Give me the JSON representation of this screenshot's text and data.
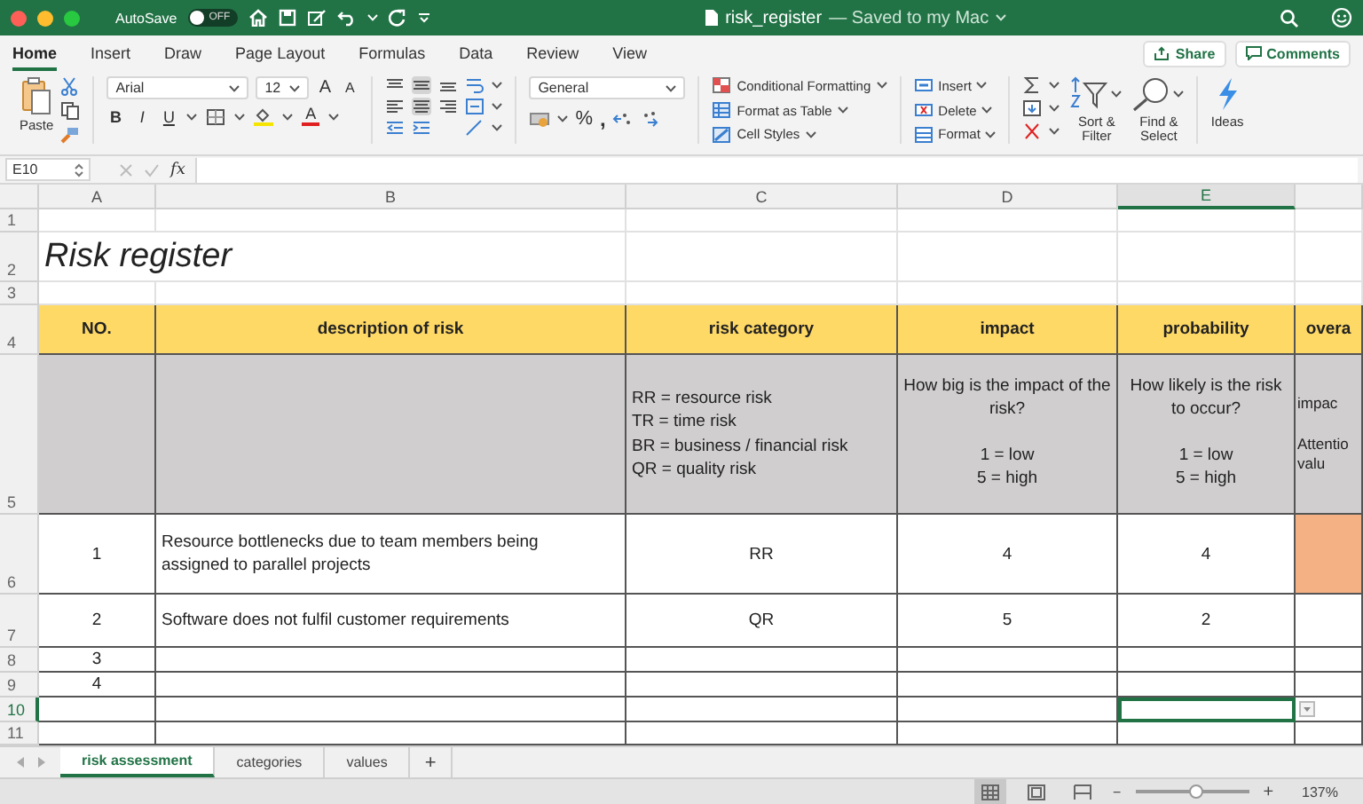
{
  "title_bar": {
    "autosave_label": "AutoSave",
    "autosave_on": false,
    "autosave_state": "OFF",
    "title": "risk_register",
    "subtitle": "— Saved to my Mac"
  },
  "ribbon_tabs": [
    {
      "label": "Home",
      "selected": true
    },
    {
      "label": "Insert",
      "selected": false
    },
    {
      "label": "Draw",
      "selected": false
    },
    {
      "label": "Page Layout",
      "selected": false
    },
    {
      "label": "Formulas",
      "selected": false
    },
    {
      "label": "Data",
      "selected": false
    },
    {
      "label": "Review",
      "selected": false
    },
    {
      "label": "View",
      "selected": false
    }
  ],
  "share_button": "Share",
  "comments_button": "Comments",
  "ribbon": {
    "paste": "Paste",
    "font": "Arial",
    "font_size": "12",
    "grow_font": "A",
    "shrink_font": "A",
    "bold": "B",
    "italic": "I",
    "underline": "U",
    "font_color": "A",
    "number_format": "General",
    "percent": "%",
    "comma": ",",
    "styles": [
      "Conditional Formatting",
      "Format as Table",
      "Cell Styles"
    ],
    "cells": [
      "Insert",
      "Delete",
      "Format"
    ],
    "sort_filter": "Sort &\nFilter",
    "find_select": "Find &\nSelect",
    "ideas": "Ideas"
  },
  "formula_bar": {
    "name_box": "E10",
    "fx": "fx"
  },
  "sheet": {
    "columns": [
      {
        "label": "A",
        "selected": false
      },
      {
        "label": "B",
        "selected": false
      },
      {
        "label": "C",
        "selected": false
      },
      {
        "label": "D",
        "selected": false
      },
      {
        "label": "E",
        "selected": true
      }
    ],
    "row_numbers": [
      {
        "label": "1",
        "selected": false
      },
      {
        "label": "2",
        "selected": false
      },
      {
        "label": "3",
        "selected": false
      },
      {
        "label": "4",
        "selected": false
      },
      {
        "label": "5",
        "selected": false
      },
      {
        "label": "6",
        "selected": false
      },
      {
        "label": "7",
        "selected": false
      },
      {
        "label": "8",
        "selected": false
      },
      {
        "label": "9",
        "selected": false
      },
      {
        "label": "10",
        "selected": true
      },
      {
        "label": "11",
        "selected": false
      }
    ],
    "title": "Risk register",
    "headers": [
      "NO.",
      "description of risk",
      "risk category",
      "impact",
      "probability",
      "overa"
    ],
    "legend": {
      "risk_category": "RR = resource risk\nTR = time risk\nBR = business / financial risk\nQR = quality risk",
      "impact": "How big is the impact of the risk?\n\n1 = low\n5 = high",
      "probability": "How likely is the risk to occur?\n\n1 = low\n5 = high",
      "overall": "impac\n\nAttentio\nvalu"
    },
    "rows": [
      {
        "no": "1",
        "description": "Resource bottlenecks due to team members being assigned to parallel projects",
        "category": "RR",
        "impact": "4",
        "probability": "4",
        "color": "#f4b183"
      },
      {
        "no": "2",
        "description": "Software does not fulfil customer requirements",
        "category": "QR",
        "impact": "5",
        "probability": "2"
      },
      {
        "no": "3"
      },
      {
        "no": "4"
      }
    ]
  },
  "sheet_tabs": [
    {
      "label": "risk assessment",
      "selected": true
    },
    {
      "label": "categories",
      "selected": false
    },
    {
      "label": "values",
      "selected": false
    }
  ],
  "add_sheet": "+",
  "status_bar": {
    "zoom_minus": "−",
    "zoom_plus": "+",
    "zoom": "137%",
    "level": 0.54
  }
}
